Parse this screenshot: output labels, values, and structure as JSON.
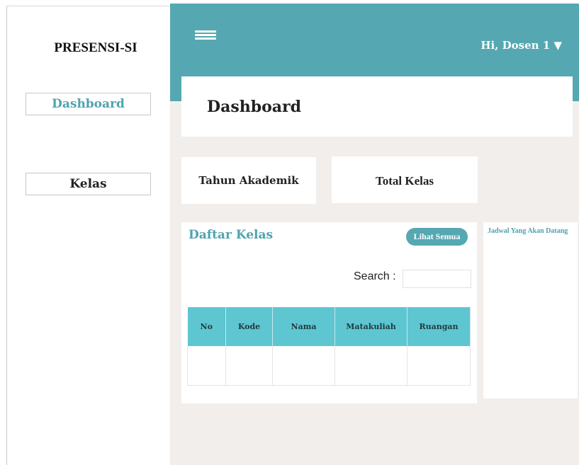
{
  "sidebar": {
    "brand": "PRESENSI-SI",
    "items": [
      {
        "label": "Dashboard",
        "active": true
      },
      {
        "label": "Kelas",
        "active": false
      }
    ]
  },
  "header": {
    "menu_icon": "hamburger-menu-icon",
    "user_label": "Hi, Dosen 1 ▼"
  },
  "main": {
    "page_title": "Dashboard",
    "stats": [
      {
        "label": "Tahun Akademik"
      },
      {
        "label": "Total Kelas"
      }
    ],
    "class_list": {
      "title": "Daftar Kelas",
      "view_all_label": "Lihat Semua",
      "search_label": "Search :",
      "search_value": "",
      "columns": [
        "No",
        "Kode",
        "Nama",
        "Matakuliah",
        "Ruangan"
      ],
      "rows": []
    },
    "upcoming": {
      "title": "Jadwal Yang Akan Datang"
    }
  },
  "colors": {
    "accent": "#55a8b1",
    "accent_text": "#4fa3ad",
    "table_header": "#5ec6d1",
    "background": "#f1eeec"
  }
}
